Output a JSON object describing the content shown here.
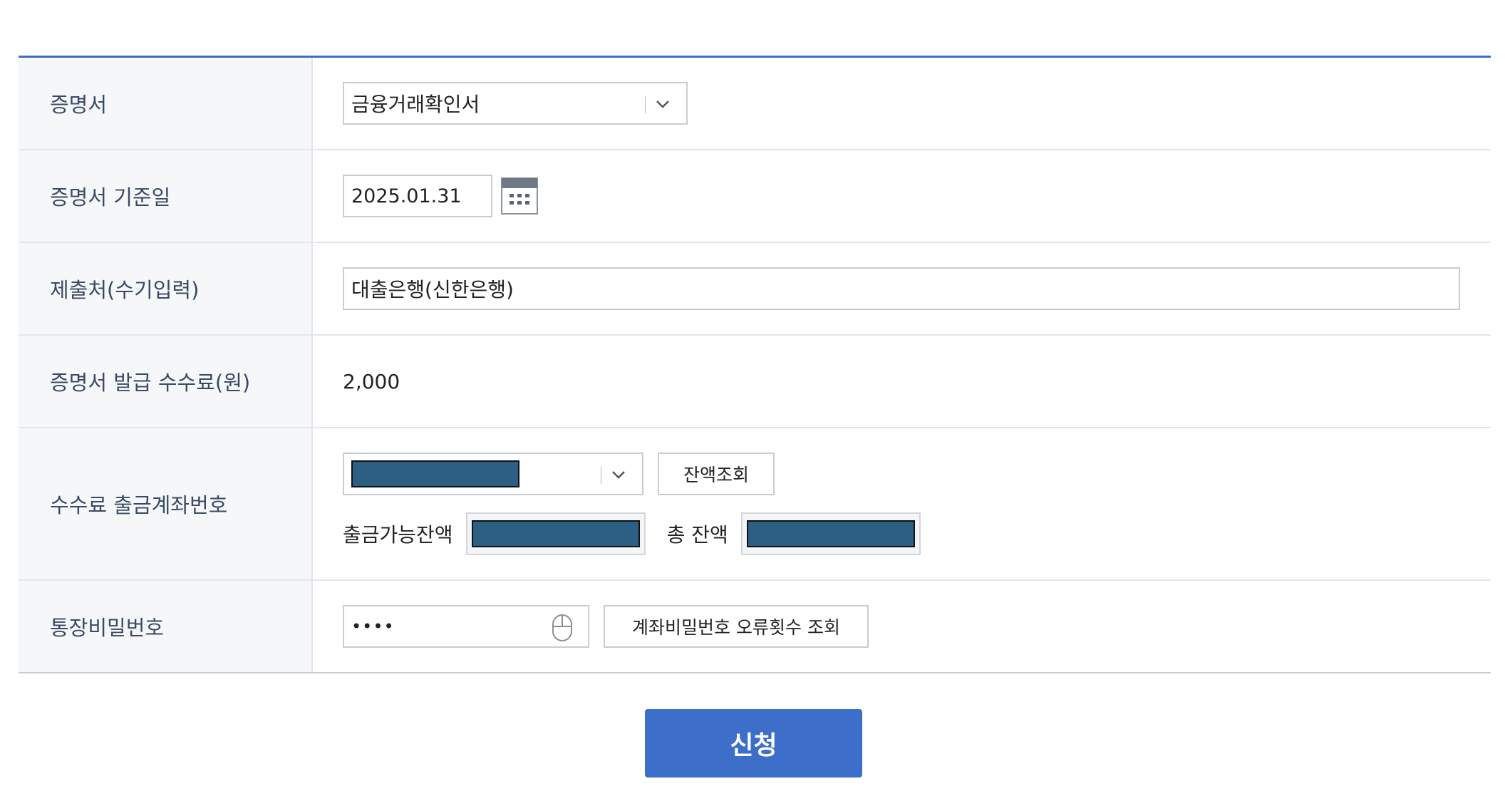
{
  "rows": {
    "certificate": {
      "label": "증명서",
      "selected": "금융거래확인서"
    },
    "base_date": {
      "label": "증명서 기준일",
      "value": "2025.01.31"
    },
    "submit_to": {
      "label": "제출처(수기입력)",
      "value": "대출은행(신한은행)"
    },
    "fee": {
      "label": "증명서 발급 수수료(원)",
      "value": "2,000"
    },
    "fee_account": {
      "label": "수수료 출금계좌번호",
      "balance_button": "잔액조회",
      "available_label": "출금가능잔액",
      "total_label": "총 잔액"
    },
    "password": {
      "label": "통장비밀번호",
      "value": "••••",
      "error_count_button": "계좌비밀번호 오류횟수 조회"
    }
  },
  "submit_label": "신청",
  "colors": {
    "accent": "#3d6fca",
    "masked": "#2b5f83",
    "label_bg": "#f6f7f9"
  }
}
